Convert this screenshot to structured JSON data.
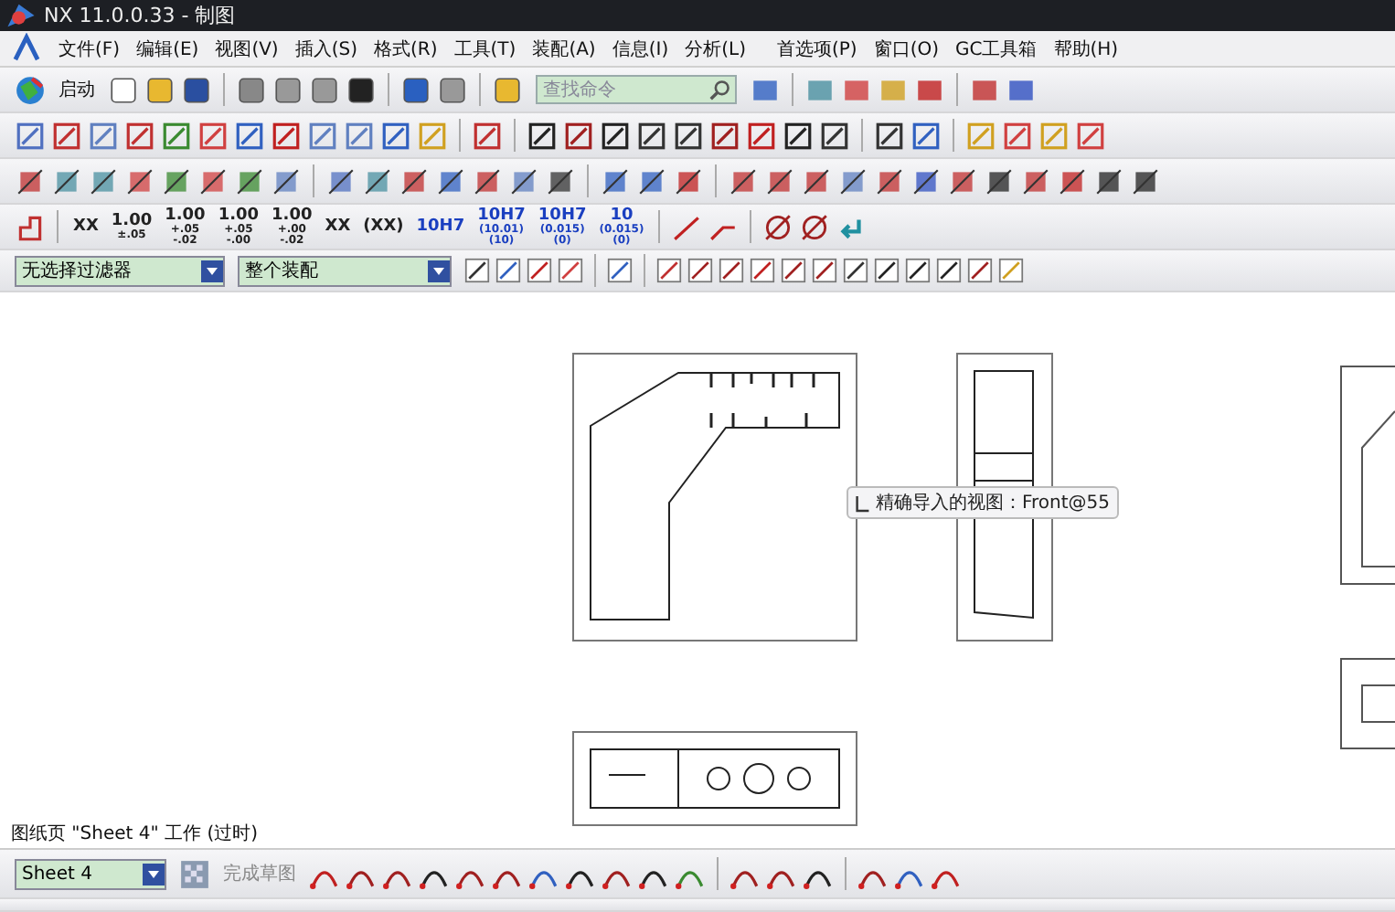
{
  "window": {
    "title": "NX 11.0.0.33 - 制图"
  },
  "menu": [
    "文件(F)",
    "编辑(E)",
    "视图(V)",
    "插入(S)",
    "格式(R)",
    "工具(T)",
    "装配(A)",
    "信息(I)",
    "分析(L)",
    "首选项(P)",
    "窗口(O)",
    "GC工具箱",
    "帮助(H)"
  ],
  "toolbar": {
    "start_label": "启动",
    "search": {
      "placeholder": "查找命令"
    }
  },
  "dimension_toolbar": [
    {
      "lines": [
        "XX"
      ],
      "kind": "tolerance"
    },
    {
      "lines": [
        "1.00",
        "±.05"
      ],
      "kind": "tolerance"
    },
    {
      "lines": [
        "1.00",
        "+.05",
        "-.02"
      ],
      "kind": "tolerance"
    },
    {
      "lines": [
        "1.00",
        "+.05",
        "-.00"
      ],
      "kind": "tolerance"
    },
    {
      "lines": [
        "1.00",
        "+.00",
        "-.02"
      ],
      "kind": "tolerance"
    },
    {
      "lines": [
        "XX"
      ],
      "kind": "tolerance"
    },
    {
      "lines": [
        "(XX)"
      ],
      "kind": "tolerance"
    },
    {
      "lines": [
        "10H7"
      ],
      "kind": "fit"
    },
    {
      "lines": [
        "10H7",
        "(10.01)",
        "(10)"
      ],
      "kind": "fit"
    },
    {
      "lines": [
        "10H7",
        "(0.015)",
        "(0)"
      ],
      "kind": "fit"
    },
    {
      "lines": [
        "10",
        "(0.015)",
        "(0)"
      ],
      "kind": "fit"
    }
  ],
  "filters": [
    {
      "value": "无选择过滤器"
    },
    {
      "value": "整个装配"
    }
  ],
  "drawing": {
    "tooltip": "精确导入的视图：Front@55"
  },
  "status_bar": {
    "message": "图纸页 \"Sheet 4\" 工作 (过时)"
  },
  "sketch_toolbar": {
    "sheet": "Sheet 4",
    "finish_label": "完成草图"
  }
}
